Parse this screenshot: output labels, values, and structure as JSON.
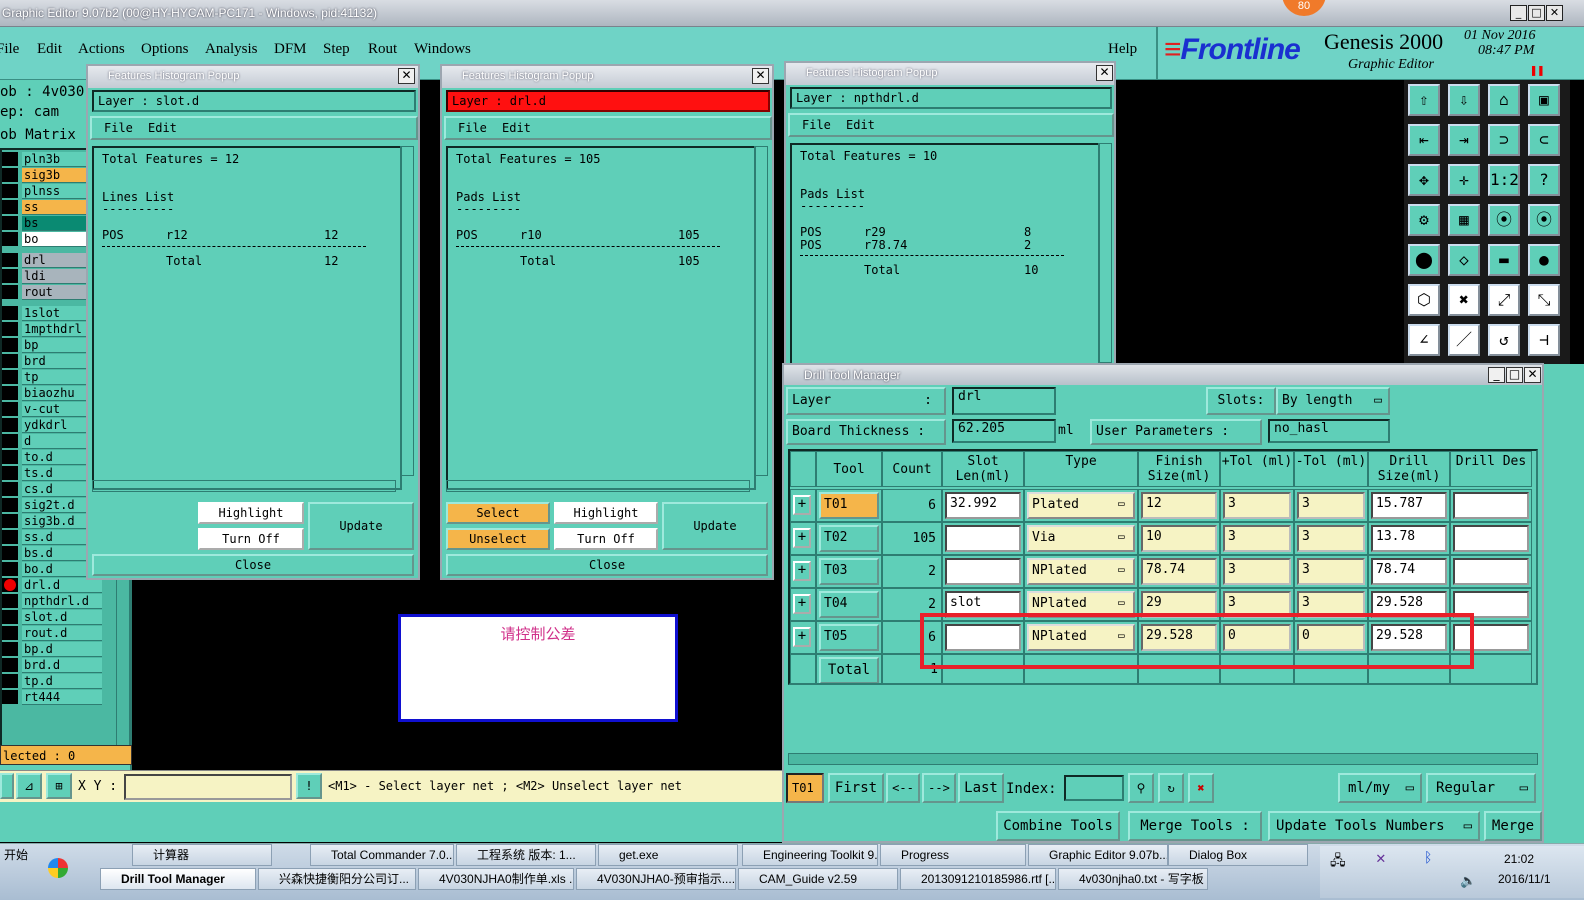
{
  "app_title": "Graphic Editor 9.07b2 (00@HY-HYCAM-PC171 - Windows, pid:41132)",
  "badge": "80",
  "menu": [
    "File",
    "Edit",
    "Actions",
    "Options",
    "Analysis",
    "DFM",
    "Step",
    "Rout",
    "Windows"
  ],
  "help": "Help",
  "brand": {
    "logo": "Frontline",
    "product": "Genesis 2000",
    "subtitle": "Graphic Editor",
    "date": "01 Nov 2016",
    "time": "08:47 PM"
  },
  "left": {
    "job": "ob : 4v030",
    "step": "ep: cam",
    "matrix": "ob Matrix",
    "layers": [
      "pln3b",
      "sig3b",
      "plnss",
      "ss",
      "bs",
      "bo",
      "drl",
      "ldi",
      "rout",
      "1slot",
      "1mpthdrl",
      "bp",
      "brd",
      "tp",
      "biaozhu",
      "v-cut",
      "ydkdrl",
      "d",
      "to.d",
      "ts.d",
      "cs.d",
      "sig2t.d",
      "sig3b.d",
      "ss.d",
      "bs.d",
      "bo.d",
      "drl.d",
      "npthdrl.d",
      "slot.d",
      "rout.d",
      "bp.d",
      "brd.d",
      "tp.d",
      "rt444"
    ],
    "selected": "lected : 0"
  },
  "popup1": {
    "title": "Features Histogram Popup",
    "layer": "Layer :  slot.d",
    "file": "File",
    "edit": "Edit",
    "total": "Total Features = 12",
    "list_title": "Lines List",
    "list_sep": "----------",
    "rows": [
      {
        "pol": "POS",
        "sym": "r12",
        "cnt": "12"
      }
    ],
    "total_label": "Total",
    "total_val": "12",
    "highlight": "Highlight",
    "turnoff": "Turn Off",
    "update": "Update",
    "close": "Close"
  },
  "popup2": {
    "title": "Features Histogram Popup",
    "layer": "Layer :  drl.d",
    "file": "File",
    "edit": "Edit",
    "total": "Total Features = 105",
    "list_title": "Pads List",
    "list_sep": "---------",
    "rows": [
      {
        "pol": "POS",
        "sym": "r10",
        "cnt": "105"
      }
    ],
    "total_label": "Total",
    "total_val": "105",
    "select": "Select",
    "unselect": "Unselect",
    "highlight": "Highlight",
    "turnoff": "Turn Off",
    "update": "Update",
    "close": "Close"
  },
  "popup3": {
    "title": "Features Histogram Popup",
    "layer": "Layer :  npthdrl.d",
    "file": "File",
    "edit": "Edit",
    "total": "Total Features = 10",
    "list_title": "Pads List",
    "list_sep": "---------",
    "rows": [
      {
        "pol": "POS",
        "sym": "r29",
        "cnt": "8"
      },
      {
        "pol": "POS",
        "sym": "r78.74",
        "cnt": "2"
      }
    ],
    "total_label": "Total",
    "total_val": "10"
  },
  "note": "请控制公差",
  "dtm": {
    "title": "Drill Tool Manager",
    "layer_label": "Layer",
    "layer_val": "drl",
    "slots_label": "Slots:",
    "slots_val": "By length",
    "thick_label": "Board Thickness :",
    "thick_val": "62.205",
    "thick_unit": "ml",
    "user_params": "User Parameters :",
    "user_params_val": "no_hasl",
    "headers": [
      "Tool",
      "Count",
      "Slot Len(ml)",
      "Type",
      "Finish Size(ml)",
      "+Tol (ml)",
      "-Tol (ml)",
      "Drill Size(ml)",
      "Drill Des"
    ],
    "rows": [
      {
        "tool": "T01",
        "count": "6",
        "slot": "32.992",
        "type": "Plated",
        "finish": "12",
        "ptol": "3",
        "ntol": "3",
        "drill": "15.787",
        "des": ""
      },
      {
        "tool": "T02",
        "count": "105",
        "slot": "",
        "type": "Via",
        "finish": "10",
        "ptol": "3",
        "ntol": "3",
        "drill": "13.78",
        "des": ""
      },
      {
        "tool": "T03",
        "count": "2",
        "slot": "",
        "type": "NPlated",
        "finish": "78.74",
        "ptol": "3",
        "ntol": "3",
        "drill": "78.74",
        "des": ""
      },
      {
        "tool": "T04",
        "count": "2",
        "slot": "slot",
        "type": "NPlated",
        "finish": "29",
        "ptol": "3",
        "ntol": "3",
        "drill": "29.528",
        "des": ""
      },
      {
        "tool": "T05",
        "count": "6",
        "slot": "",
        "type": "NPlated",
        "finish": "29.528",
        "ptol": "0",
        "ntol": "0",
        "drill": "29.528",
        "des": ""
      }
    ],
    "total_label": "Total",
    "total_val": "1",
    "nav_tool": "T01",
    "first": "First",
    "prev": "<--",
    "next": "-->",
    "last": "Last",
    "index": "Index:",
    "units": "ml/my",
    "mode": "Regular",
    "combine": "Combine Tools",
    "merge_tools": "Merge Tools :",
    "update_nums": "Update Tools Numbers",
    "merge": "Merge"
  },
  "status": {
    "xy": "X Y :",
    "hint": "<M1> - Select layer net ; <M2> Unselect layer net"
  },
  "taskbar": {
    "start": "开始",
    "row1": [
      "计算器",
      "Total Commander 7.0...",
      "工程系统  版本: 1...",
      "get.exe",
      "Engineering Toolkit 9....",
      "Progress",
      "Graphic Editor 9.07b...",
      "Dialog Box"
    ],
    "row2": [
      "Drill Tool Manager",
      "兴森快捷衡阳分公司订...",
      "4V030NJHA0制作单.xls ...",
      "4V030NJHA0-预审指示....",
      "CAM_Guide v2.59",
      "2013091210185986.rtf [...",
      "4v030njha0.txt - 写字板"
    ],
    "time": "21:02",
    "date": "2016/11/1"
  }
}
